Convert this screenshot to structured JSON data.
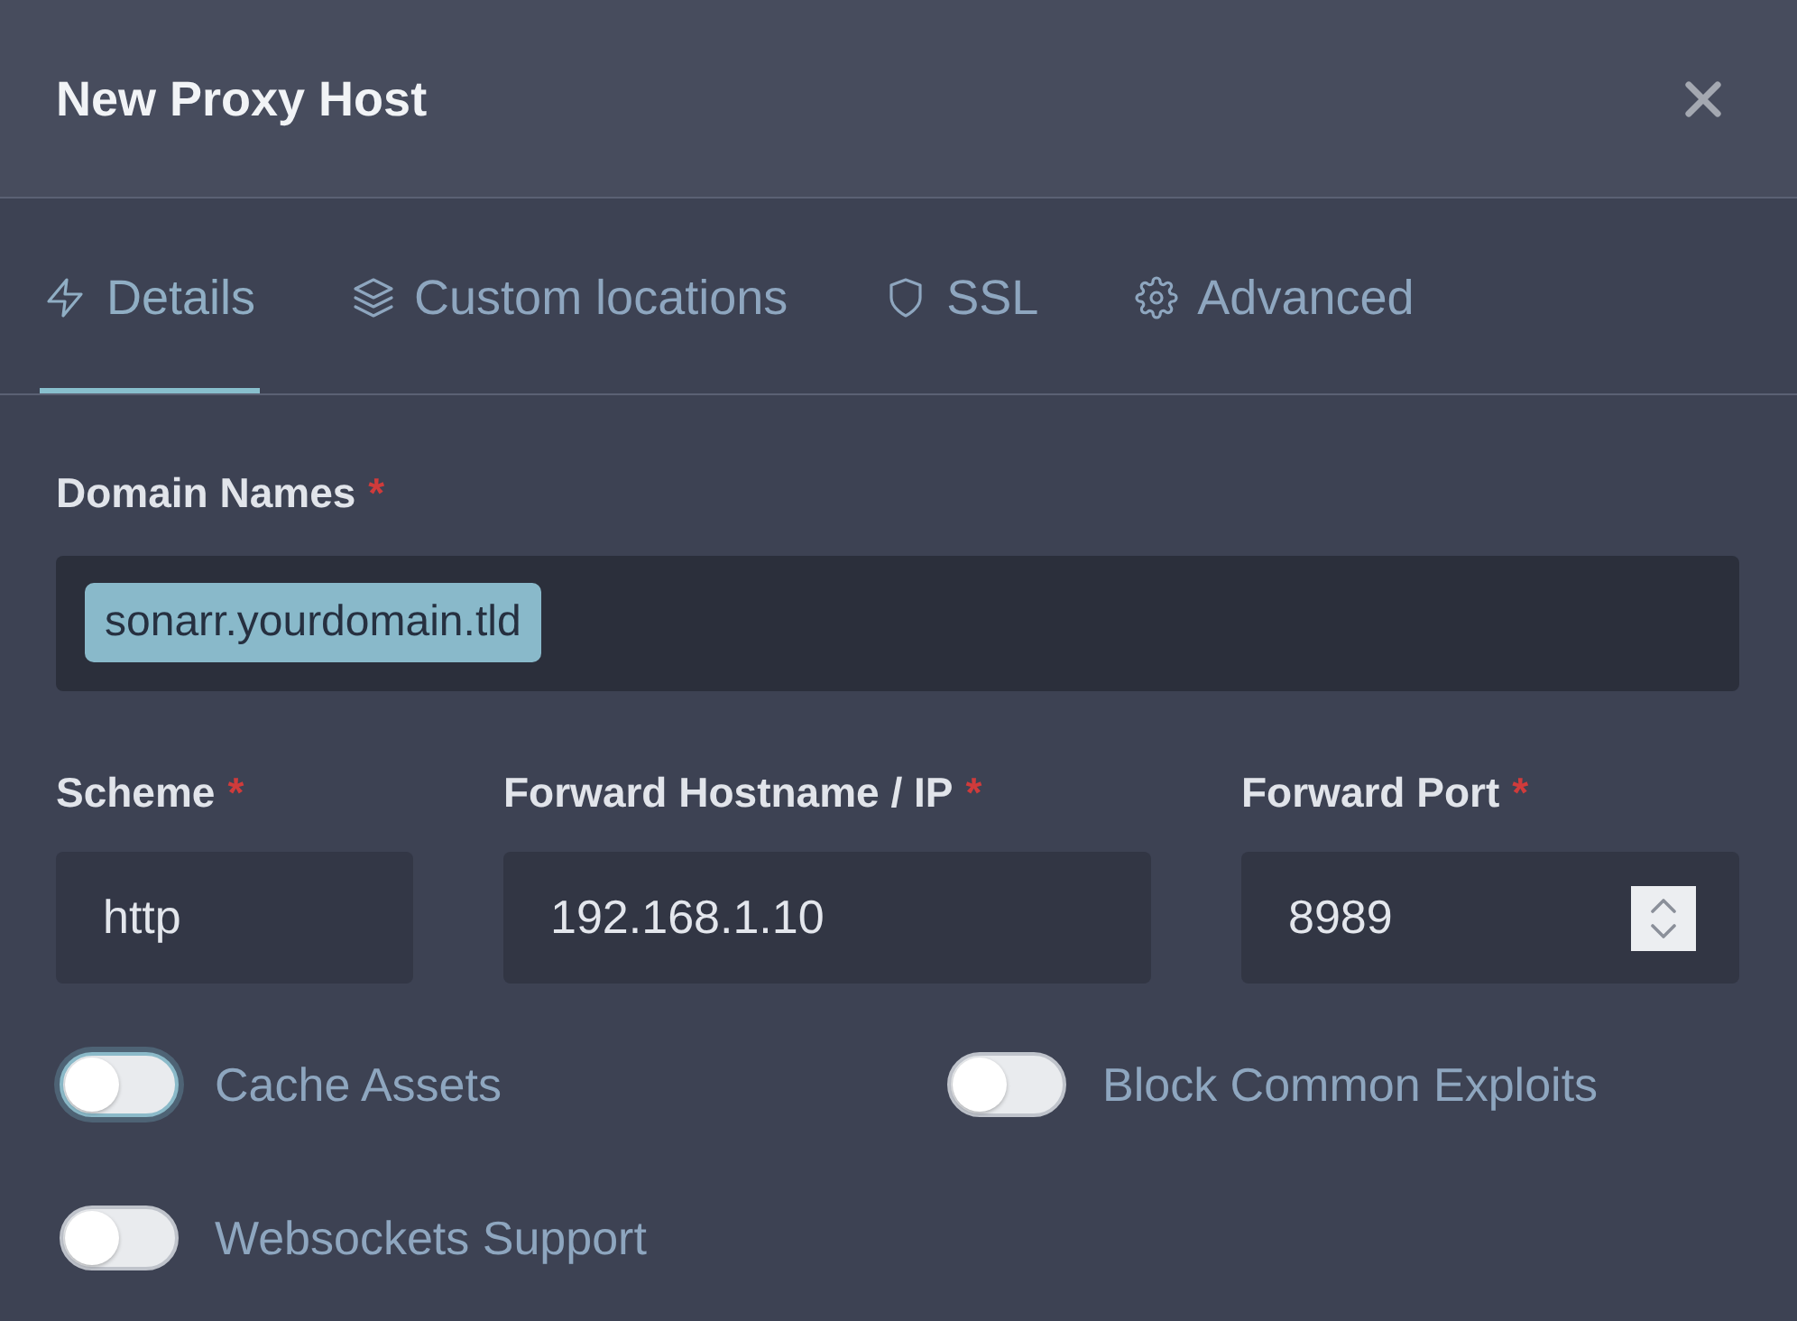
{
  "dialog": {
    "title": "New Proxy Host"
  },
  "tabs": [
    {
      "label": "Details",
      "selected": true
    },
    {
      "label": "Custom locations",
      "selected": false
    },
    {
      "label": "SSL",
      "selected": false
    },
    {
      "label": "Advanced",
      "selected": false
    }
  ],
  "domain_names": {
    "label": "Domain Names",
    "required_mark": "*",
    "values": [
      "sonarr.yourdomain.tld"
    ]
  },
  "fields": [
    {
      "kind": "select",
      "label": "Scheme",
      "required_mark": "*",
      "value": "http"
    },
    {
      "kind": "text",
      "label": "Forward Hostname / IP",
      "required_mark": "*",
      "value": "192.168.1.10"
    },
    {
      "kind": "number",
      "label": "Forward Port",
      "required_mark": "*",
      "value": "8989"
    }
  ],
  "options": [
    {
      "label": "Cache Assets",
      "on": false,
      "focused": true
    },
    {
      "label": "Block Common Exploits",
      "on": false,
      "focused": false
    },
    {
      "label": "Websockets Support",
      "on": false,
      "focused": false
    }
  ]
}
